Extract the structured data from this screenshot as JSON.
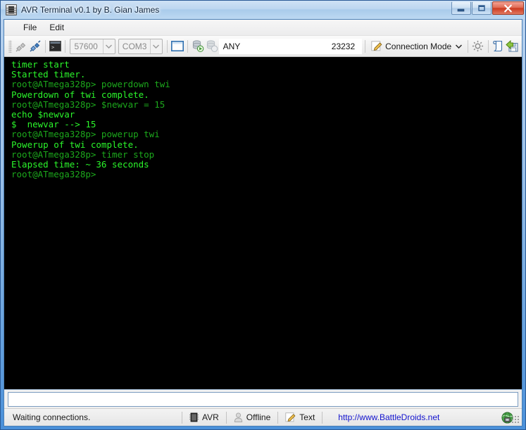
{
  "window": {
    "title": "AVR Terminal v0.1 by B. Gian James",
    "icon": "chip-icon",
    "controls": {
      "minimize": "Minimize",
      "maximize": "Maximize",
      "close": "Close"
    }
  },
  "menubar": {
    "items": [
      {
        "label": "File"
      },
      {
        "label": "Edit"
      }
    ]
  },
  "toolbar": {
    "connect_icon": "plug-disconnected-icon",
    "disconnect_icon": "plug-connected-icon",
    "console_icon": "console-icon",
    "baud": {
      "value": "57600",
      "icon": "chevron-down-icon"
    },
    "port": {
      "value": "COM3",
      "icon": "chevron-down-icon"
    },
    "window_icon": "window-icon",
    "server_start_icon": "server-start-icon",
    "server_stop_icon": "server-stop-icon",
    "host": {
      "value": "ANY",
      "placeholder": "ANY"
    },
    "port_number": {
      "value": "23232",
      "placeholder": "23232"
    },
    "connection_mode": {
      "label": "Connection Mode",
      "icon": "pencil-icon",
      "dropdown_icon": "chevron-down-icon"
    },
    "settings_icon": "gear-icon",
    "script_icon": "scroll-icon",
    "save_icon": "save-icon"
  },
  "terminal": {
    "lines": [
      {
        "text": "timer start",
        "style": "bright"
      },
      {
        "text": "Started timer.",
        "style": "bright"
      },
      {
        "text": "root@ATmega328p> powerdown twi",
        "style": "prompt"
      },
      {
        "text": "Powerdown of twi complete.",
        "style": "bright"
      },
      {
        "text": "root@ATmega328p> $newvar = 15",
        "style": "prompt"
      },
      {
        "text": "echo $newvar",
        "style": "bright"
      },
      {
        "text": "$  newvar --> 15",
        "style": "bright"
      },
      {
        "text": "root@ATmega328p> powerup twi",
        "style": "prompt"
      },
      {
        "text": "Powerup of twi complete.",
        "style": "bright"
      },
      {
        "text": "root@ATmega328p> timer stop",
        "style": "prompt"
      },
      {
        "text": "Elapsed time: ~ 36 seconds",
        "style": "bright"
      },
      {
        "text": "root@ATmega328p>",
        "style": "prompt"
      }
    ]
  },
  "command_input": {
    "value": "",
    "placeholder": ""
  },
  "statusbar": {
    "status_text": "Waiting connections.",
    "device": {
      "label": "AVR",
      "icon": "chip-icon"
    },
    "connection": {
      "label": "Offline",
      "icon": "user-icon"
    },
    "mode": {
      "label": "Text",
      "icon": "pencil-icon"
    },
    "link": {
      "label": "http://www.BattleDroids.net"
    },
    "globe_icon": "globe-icon",
    "resize_grip": "resize-grip"
  },
  "colors": {
    "terminal_bg": "#000000",
    "terminal_green": "#19c219",
    "terminal_green_bright": "#2bf52b",
    "terminal_green_prompt": "#1ca81c",
    "link_blue": "#1414cf",
    "frame_blue": "#4a90d9"
  }
}
